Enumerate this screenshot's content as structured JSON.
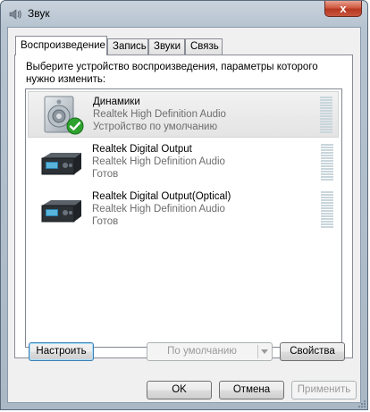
{
  "window": {
    "title": "Звук",
    "close_glyph": "x"
  },
  "tabs": [
    {
      "label": "Воспроизведение"
    },
    {
      "label": "Запись"
    },
    {
      "label": "Звуки"
    },
    {
      "label": "Связь"
    }
  ],
  "instruction": "Выберите устройство воспроизведения, параметры которого нужно изменить:",
  "devices": [
    {
      "name": "Динамики",
      "driver": "Realtek High Definition Audio",
      "status": "Устройство по умолчанию",
      "icon": "speaker-icon"
    },
    {
      "name": "Realtek Digital Output",
      "driver": "Realtek High Definition Audio",
      "status": "Готов",
      "icon": "digital-output-icon"
    },
    {
      "name": "Realtek Digital Output(Optical)",
      "driver": "Realtek High Definition Audio",
      "status": "Готов",
      "icon": "digital-output-icon"
    }
  ],
  "buttons": {
    "configure": "Настроить",
    "set_default": "По умолчанию",
    "properties": "Свойства",
    "ok": "OK",
    "cancel": "Отмена",
    "apply": "Применить"
  },
  "colors": {
    "check_green": "#2ea22e",
    "meter": "#c9d6dc",
    "close_red": "#c8563e"
  }
}
